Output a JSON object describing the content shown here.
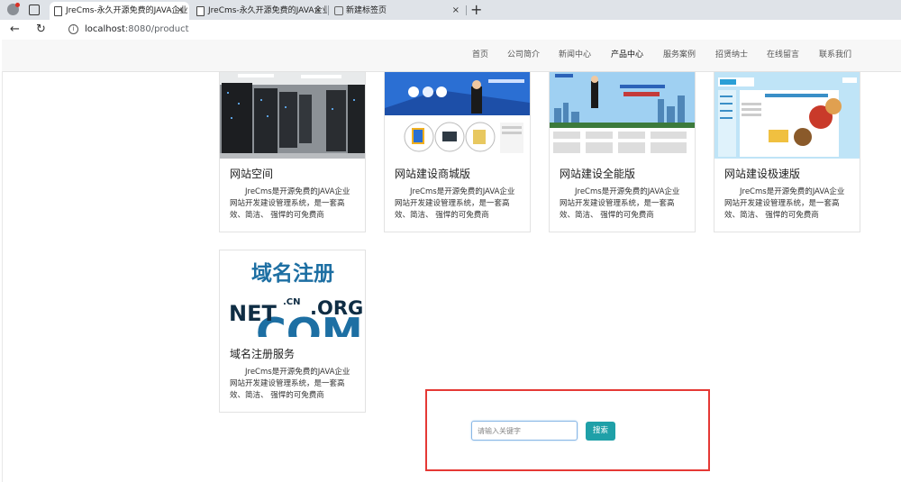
{
  "browser": {
    "tabs": [
      {
        "title": "JreCms-永久开源免费的JAVA企业",
        "active": true
      },
      {
        "title": "JreCms-永久开源免费的JAVA企业",
        "active": false
      },
      {
        "title": "新建标签页",
        "active": false
      }
    ],
    "address": {
      "host": "localhost",
      "path": ":8080/product"
    }
  },
  "nav": {
    "items": [
      "首页",
      "公司简介",
      "新闻中心",
      "产品中心",
      "服务案例",
      "招贤纳士",
      "在线留言",
      "联系我们"
    ],
    "active": "产品中心"
  },
  "products": [
    {
      "name": "网站空间",
      "desc": "JreCms是开源免费的JAVA企业网站开发建设管理系统，是一套高效、简洁、 强悍的可免费商"
    },
    {
      "name": "网站建设商城版",
      "desc": "JreCms是开源免费的JAVA企业网站开发建设管理系统，是一套高效、简洁、 强悍的可免费商"
    },
    {
      "name": "网站建设全能版",
      "desc": "JreCms是开源免费的JAVA企业网站开发建设管理系统，是一套高效、简洁、 强悍的可免费商"
    },
    {
      "name": "网站建设极速版",
      "desc": "JreCms是开源免费的JAVA企业网站开发建设管理系统，是一套高效、简洁、 强悍的可免费商"
    },
    {
      "name": "域名注册服务",
      "desc": "JreCms是开源免费的JAVA企业网站开发建设管理系统，是一套高效、简洁、 强悍的可免费商"
    }
  ],
  "domain_image": {
    "title": "域名注册",
    "tlds": [
      "NET",
      ".CN",
      ".ORG",
      "COM"
    ]
  },
  "search": {
    "placeholder": "请输入关键字",
    "button_label": "搜索"
  },
  "colors": {
    "accent": "#1fa0a8",
    "highlight_border": "#e53935",
    "header_bg": "#f7f7f7",
    "domain_blue": "#1d6fa3"
  }
}
